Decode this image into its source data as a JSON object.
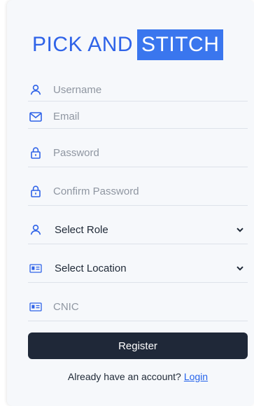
{
  "brand": {
    "part1": "PICK AND",
    "part2": "STITCH"
  },
  "form": {
    "username_placeholder": "Username",
    "email_placeholder": "Email",
    "password_placeholder": "Password",
    "confirm_password_placeholder": "Confirm Password",
    "role_select": {
      "label": "Select Role"
    },
    "location_select": {
      "label": "Select Location"
    },
    "cnic_placeholder": "CNIC",
    "register_label": "Register"
  },
  "footer": {
    "prompt": "Already have an account?",
    "login_link": "Login"
  },
  "colors": {
    "brand_blue": "#3a76ee",
    "icon_blue": "#2f63e8",
    "button_dark": "#1f2838",
    "link_blue": "#2563eb"
  },
  "icons": {
    "username": "user-icon",
    "email": "mail-icon",
    "password": "lock-icon",
    "confirm_password": "lock-icon",
    "role": "user-icon",
    "location": "id-card-icon",
    "cnic": "id-card-icon",
    "dropdown": "chevron-down-icon"
  }
}
